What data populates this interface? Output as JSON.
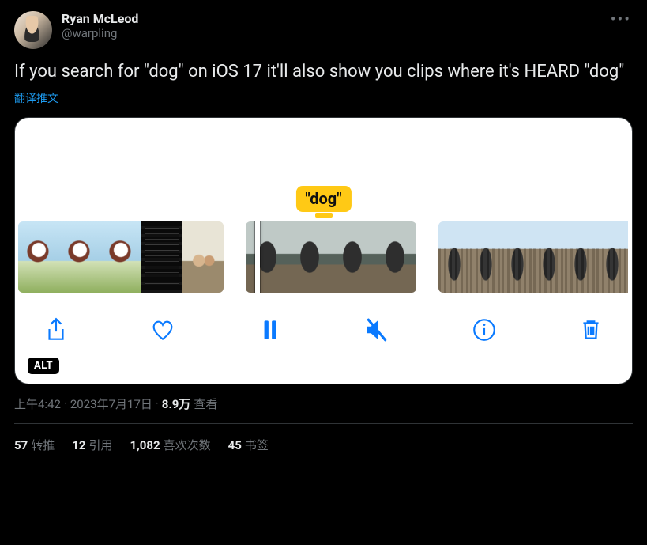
{
  "user": {
    "display_name": "Ryan McLeod",
    "handle": "@warpling"
  },
  "tweet": {
    "text": "If you search for \"dog\" on iOS 17 it'll also show you clips where it's HEARD \"dog\"",
    "translate_label": "翻译推文",
    "alt_badge": "ALT",
    "tooltip": "\"dog\""
  },
  "meta": {
    "time": "上午4:42",
    "separator": " · ",
    "date": "2023年7月17日",
    "views_count": "8.9万",
    "views_label": " 查看"
  },
  "stats": {
    "retweets_count": "57",
    "retweets_label": "转推",
    "quotes_count": "12",
    "quotes_label": "引用",
    "likes_count": "1,082",
    "likes_label": "喜欢次数",
    "bookmarks_count": "45",
    "bookmarks_label": "书签"
  }
}
